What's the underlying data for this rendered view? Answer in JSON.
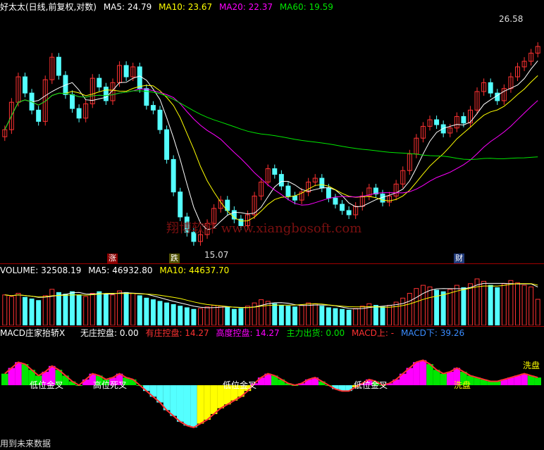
{
  "price_panel": {
    "title": "好太太(日线,前复权,对数)",
    "ma5": "MA5: 24.79",
    "ma10": "MA10: 23.67",
    "ma20": "MA20: 22.37",
    "ma60": "MA60: 19.59",
    "high_label": "26.58",
    "low_label": "15.07",
    "tag_zhang": "涨",
    "tag_die": "跌",
    "tag_cai": "财",
    "watermark": "翔博软件 www.xiangbosoft.com",
    "colors": {
      "up": "#ff3232",
      "down": "#54ffff",
      "ma5": "#ffffff",
      "ma10": "#ffff00",
      "ma20": "#ff00ff",
      "ma60": "#00e600"
    }
  },
  "volume_panel": {
    "vol": "VOLUME: 32508.19",
    "ma5": "MA5: 46932.80",
    "ma10": "MA10: 44637.70"
  },
  "macd_panel": {
    "title": "MACD庄家抬轿X",
    "no_control": "无庄控盘: 0.00",
    "has_control": "有庄控盘: 14.27",
    "high_control": "高度控盘: 14.27",
    "main_out": "主力出货: 0.00",
    "macd_up": "MACD上: -",
    "macd_down": "MACD下: 39.26",
    "labels": [
      "低位金叉",
      "高位死叉",
      "低位金叉",
      "低位金叉",
      "洗盘",
      "洗盘"
    ],
    "footer": "用到未来数据"
  },
  "chart_data": {
    "type": "candlestick",
    "title": "好太太(日线,前复权,对数)",
    "price_ylim": [
      14.5,
      28.5
    ],
    "high": 26.58,
    "low": 15.07,
    "close": [
      20.8,
      22.5,
      24.2,
      23.1,
      22.0,
      21.3,
      24.0,
      25.6,
      24.3,
      23.0,
      22.1,
      21.5,
      22.4,
      24.1,
      23.5,
      22.6,
      23.8,
      25.0,
      24.2,
      24.9,
      23.4,
      22.3,
      22.0,
      20.8,
      19.1,
      17.4,
      16.2,
      15.5,
      15.1,
      15.4,
      15.9,
      16.6,
      17.0,
      16.5,
      16.1,
      15.8,
      16.3,
      17.2,
      17.9,
      18.6,
      18.3,
      17.7,
      17.2,
      17.0,
      17.4,
      17.9,
      18.1,
      17.6,
      17.1,
      16.8,
      16.5,
      16.3,
      16.7,
      17.2,
      17.6,
      17.3,
      16.9,
      17.2,
      17.8,
      18.5,
      19.4,
      20.3,
      21.0,
      21.4,
      21.1,
      20.6,
      20.9,
      21.6,
      21.2,
      22.0,
      23.2,
      23.8,
      23.1,
      22.6,
      23.4,
      24.2,
      24.9,
      25.3,
      25.9,
      26.4
    ],
    "volume": [
      38000,
      36000,
      40000,
      35000,
      33000,
      31000,
      37000,
      45000,
      41000,
      39000,
      42000,
      38000,
      36000,
      40000,
      42000,
      39000,
      38000,
      43000,
      41000,
      40000,
      37000,
      34000,
      32000,
      30000,
      28000,
      26000,
      24000,
      22000,
      20000,
      21000,
      23000,
      25000,
      24000,
      22000,
      20000,
      21000,
      24000,
      28000,
      32000,
      30000,
      27000,
      25000,
      24000,
      23000,
      25000,
      28000,
      27000,
      24000,
      22000,
      21000,
      20000,
      19000,
      21000,
      24000,
      27000,
      25000,
      23000,
      25000,
      29000,
      34000,
      40000,
      46000,
      50000,
      48000,
      44000,
      42000,
      45000,
      50000,
      47000,
      52000,
      58000,
      55000,
      50000,
      47000,
      52000,
      56000,
      53000,
      50000,
      48000,
      32508
    ],
    "macd": [
      0.6,
      0.9,
      1.2,
      1.1,
      0.8,
      0.5,
      0.7,
      1.0,
      0.8,
      0.5,
      0.2,
      0.0,
      0.3,
      0.6,
      0.5,
      0.3,
      0.4,
      0.6,
      0.4,
      0.3,
      0.0,
      -0.3,
      -0.6,
      -0.9,
      -1.3,
      -1.6,
      -1.9,
      -2.1,
      -2.2,
      -2.0,
      -1.8,
      -1.5,
      -1.2,
      -1.0,
      -0.8,
      -0.6,
      -0.3,
      0.1,
      0.4,
      0.6,
      0.5,
      0.3,
      0.1,
      0.0,
      0.1,
      0.3,
      0.4,
      0.2,
      0.0,
      -0.2,
      -0.3,
      -0.3,
      -0.1,
      0.1,
      0.3,
      0.2,
      0.0,
      0.1,
      0.3,
      0.6,
      0.9,
      1.2,
      1.3,
      1.1,
      0.8,
      0.6,
      0.7,
      0.9,
      0.7,
      0.5,
      0.4,
      0.3,
      0.2,
      0.2,
      0.3,
      0.4,
      0.5,
      0.6,
      0.5,
      0.4
    ]
  }
}
